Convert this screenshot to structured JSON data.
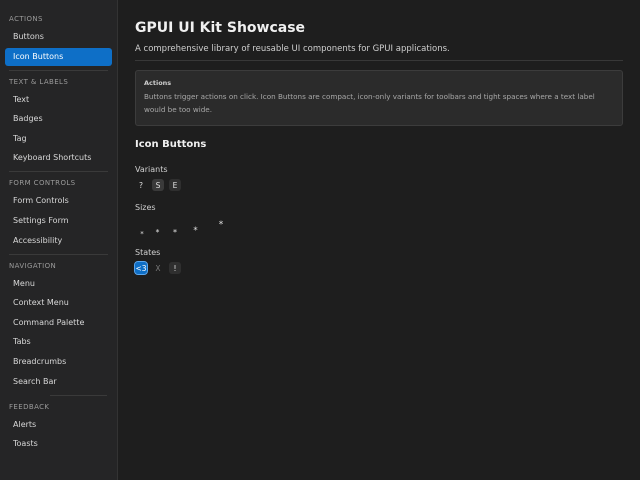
{
  "sidebar": {
    "sections": [
      {
        "title": "ACTIONS",
        "items": [
          "Buttons",
          "Icon Buttons"
        ]
      },
      {
        "title": "TEXT & LABELS",
        "items": [
          "Text",
          "Badges",
          "Tag",
          "Keyboard Shortcuts"
        ]
      },
      {
        "title": "FORM CONTROLS",
        "items": [
          "Form Controls",
          "Settings Form",
          "Accessibility"
        ]
      },
      {
        "title": "NAVIGATION",
        "items": [
          "Menu",
          "Context Menu",
          "Command Palette",
          "Tabs",
          "Breadcrumbs",
          "Search Bar"
        ]
      },
      {
        "title": "FEEDBACK",
        "items": [
          "Alerts",
          "Toasts"
        ]
      }
    ],
    "active_item": "Icon Buttons"
  },
  "main": {
    "title": "GPUI UI Kit Showcase",
    "subtitle": "A comprehensive library of reusable UI components for GPUI applications.",
    "callout": {
      "title": "Actions",
      "body": "Buttons trigger actions on click. Icon Buttons are compact, icon-only variants for toolbars and tight spaces where a text label would be too wide."
    },
    "section_heading": "Icon Buttons",
    "variants": {
      "label": "Variants",
      "buttons": [
        {
          "glyph": "?",
          "style": "ghost"
        },
        {
          "glyph": "S",
          "style": "filled"
        },
        {
          "glyph": "E",
          "style": "subtle"
        }
      ]
    },
    "sizes": {
      "label": "Sizes",
      "glyph": "*",
      "count": 5
    },
    "states": {
      "label": "States",
      "buttons": [
        {
          "glyph": "<3",
          "state": "selected"
        },
        {
          "glyph": "X",
          "state": "disabled"
        },
        {
          "glyph": "!",
          "state": "normal"
        }
      ]
    }
  },
  "colors": {
    "accent": "#0e6fc7",
    "background": "#1e1e1e",
    "sidebar": "#252526"
  }
}
